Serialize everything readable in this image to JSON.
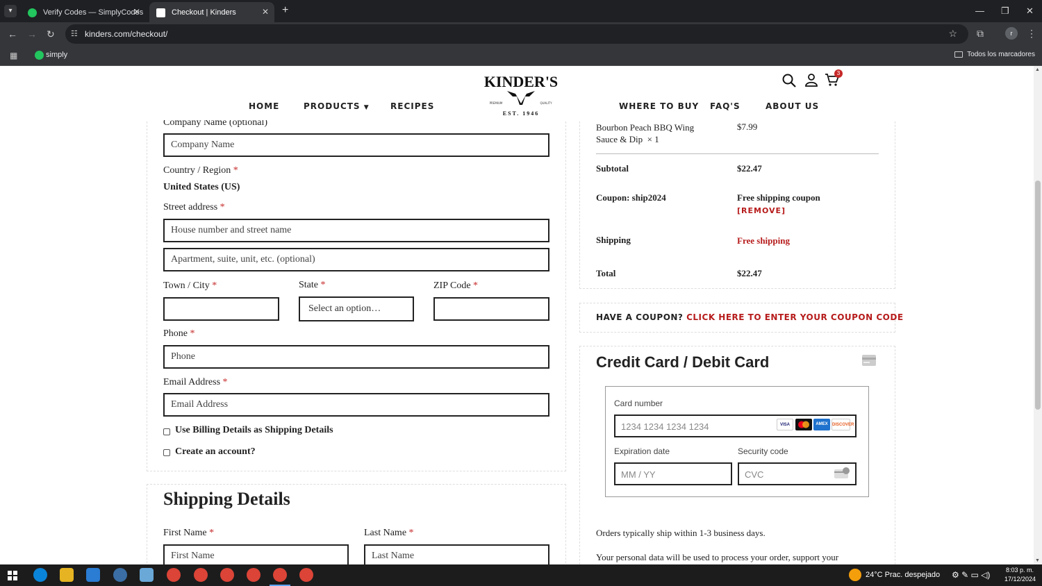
{
  "browser": {
    "tabs": [
      {
        "title": "Verify Codes — SimplyCodes",
        "active": false
      },
      {
        "title": "Checkout | Kinders",
        "active": true
      }
    ],
    "url": "kinders.com/checkout/",
    "bookmark": "simply",
    "bookmarks_folder": "Todos los marcadores",
    "profile_initial": "r"
  },
  "header": {
    "logo_text": "KINDER'S",
    "logo_sub": "EST. 1946",
    "logo_premium": "PREMIUM",
    "logo_quality": "QUALITY",
    "menu": [
      "HOME",
      "PRODUCTS",
      "RECIPES",
      "WHERE TO BUY",
      "FAQ'S",
      "ABOUT US"
    ],
    "cart_count": "3"
  },
  "billing": {
    "company_label": "Company Name (optional)",
    "company_placeholder": "Company Name",
    "country_label": "Country / Region",
    "country_value": "United States (US)",
    "street_label": "Street address",
    "street_placeholder": "House number and street name",
    "apt_placeholder": "Apartment, suite, unit, etc. (optional)",
    "city_label": "Town / City",
    "state_label": "State",
    "state_value": "Select an option…",
    "zip_label": "ZIP Code",
    "phone_label": "Phone",
    "phone_placeholder": "Phone",
    "email_label": "Email Address",
    "email_placeholder": "Email Address",
    "use_billing_label": "Use Billing Details as Shipping Details",
    "create_account_label": "Create an account?",
    "required_mark": "*"
  },
  "shipping": {
    "title": "Shipping Details",
    "first_name_label": "First Name",
    "first_name_placeholder": "First Name",
    "last_name_label": "Last Name",
    "last_name_placeholder": "Last Name"
  },
  "order": {
    "item_name": "Bourbon Peach BBQ Wing Sauce & Dip",
    "item_name_line1": "Bourbon Peach BBQ Wing",
    "item_name_line2": "Sauce & Dip",
    "item_qty": "× 1",
    "item_price": "$7.99",
    "subtotal_label": "Subtotal",
    "subtotal_value": "$22.47",
    "coupon_label": "Coupon: ship2024",
    "coupon_value": "Free shipping coupon",
    "coupon_remove": "[REMOVE]",
    "shipping_label": "Shipping",
    "shipping_value": "Free shipping",
    "total_label": "Total",
    "total_value": "$22.47"
  },
  "coupon_prompt": {
    "question": "HAVE A COUPON?",
    "link": "CLICK HERE TO ENTER YOUR COUPON CODE"
  },
  "payment": {
    "title": "Credit Card / Debit Card",
    "card_number_label": "Card number",
    "card_number_placeholder": "1234 1234 1234 1234",
    "expiry_label": "Expiration date",
    "expiry_placeholder": "MM / YY",
    "cvc_label": "Security code",
    "cvc_placeholder": "CVC",
    "brands": [
      "VISA",
      "mastercard",
      "AMEX",
      "DISCOVER"
    ],
    "ship_note": "Orders typically ship within 1-3 business days.",
    "privacy_note": "Your personal data will be used to process your order, support your"
  },
  "taskbar": {
    "weather": "24°C  Prac. despejado",
    "time": "8:03 p. m.",
    "date": "17/12/2024"
  },
  "colors": {
    "accent_red": "#b71c1c",
    "chrome_dark": "#1f2023",
    "chrome_mid": "#35363a"
  }
}
